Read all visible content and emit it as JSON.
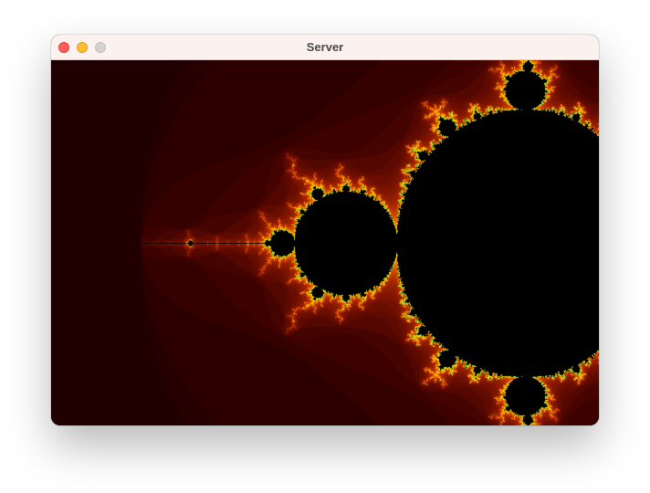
{
  "window": {
    "title": "Server",
    "controls": {
      "close": {
        "icon": "close-icon",
        "color": "#fe5f57"
      },
      "minimize": {
        "icon": "minimize-icon",
        "color": "#febc2e"
      },
      "zoom": {
        "icon": "zoom-icon",
        "color": "#d6d2d1"
      }
    }
  },
  "view": {
    "content": "mandelbrot-set-render",
    "colors": {
      "inside": "#000000",
      "background": "#1a0000",
      "outer_band": "#3a0000",
      "mid_band": "#6a0800",
      "near_band": "#b02800",
      "edge_orange": "#ff8c00",
      "edge_yellow": "#ffe000",
      "edge_green": "#40d040"
    }
  }
}
